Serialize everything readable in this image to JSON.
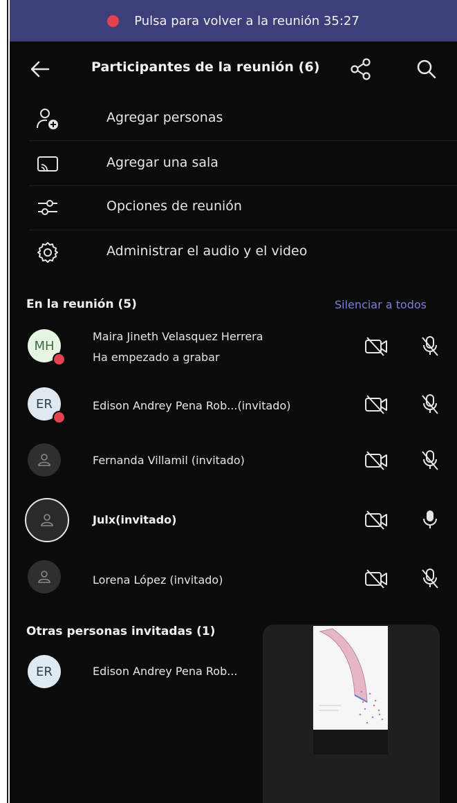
{
  "banner": {
    "text": "Pulsa para volver a la reunión 35:27"
  },
  "header": {
    "title": "Participantes de la reunión (6)",
    "back_icon": "arrow-left-icon",
    "share_icon": "share-icon",
    "search_icon": "search-icon"
  },
  "actions": [
    {
      "label": "Agregar personas",
      "icon": "add-person-icon"
    },
    {
      "label": "Agregar una sala",
      "icon": "cast-room-icon"
    },
    {
      "label": "Opciones de reunión",
      "icon": "sliders-icon"
    },
    {
      "label": "Administrar el audio y el video",
      "icon": "gear-icon"
    }
  ],
  "in_meeting": {
    "title": "En la reunión (5)",
    "mute_all": "Silenciar a todos",
    "participants": [
      {
        "initials": "MH",
        "name": "Maira Jineth Velasquez Herrera",
        "status": "Ha empezado a grabar",
        "camera": "off",
        "mic": "muted"
      },
      {
        "initials": "ER",
        "name": "Edison Andrey Pena Rob...(invitado)",
        "status": "",
        "camera": "off",
        "mic": "muted"
      },
      {
        "initials": "",
        "name": "Fernanda Villamil (invitado)",
        "status": "",
        "camera": "off",
        "mic": "muted"
      },
      {
        "initials": "",
        "name": "Julx(invitado)",
        "status": "",
        "camera": "off",
        "mic": "on"
      },
      {
        "initials": "",
        "name": "Lorena López (invitado)",
        "status": "",
        "camera": "off",
        "mic": "muted"
      }
    ]
  },
  "others_invited": {
    "title": "Otras personas invitadas (1)",
    "participants": [
      {
        "initials": "ER",
        "name": "Edison Andrey Pena Rob..."
      }
    ]
  },
  "colors": {
    "banner": "#3d3f7a",
    "accent": "#7a7fe0",
    "recording": "#e2434f",
    "background": "#0b0b0b"
  }
}
